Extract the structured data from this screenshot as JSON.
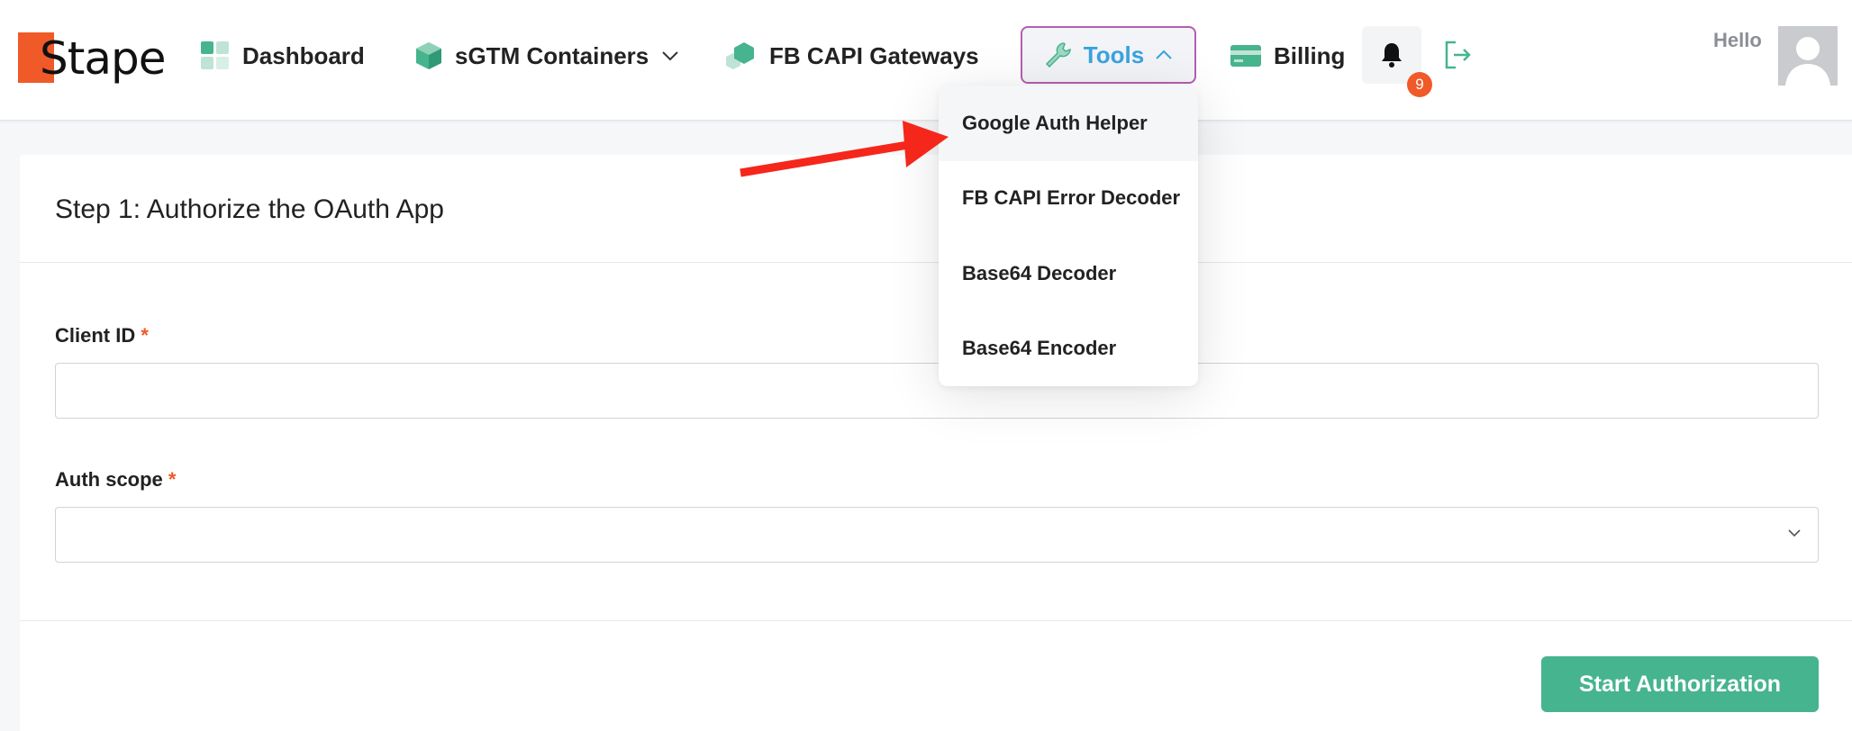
{
  "brand": {
    "name": "Stape",
    "accent": "#f05a28",
    "green": "#46b48e",
    "blue": "#3aa3e0"
  },
  "nav": {
    "dashboard": {
      "label": "Dashboard",
      "icon": "dashboard-grid-icon"
    },
    "containers": {
      "label": "sGTM Containers",
      "icon": "cube-icon"
    },
    "gateways": {
      "label": "FB CAPI Gateways",
      "icon": "hexagon-icon"
    },
    "tools": {
      "label": "Tools",
      "icon": "wrench-icon",
      "state": "open"
    },
    "billing": {
      "label": "Billing",
      "icon": "credit-card-icon"
    }
  },
  "notifications": {
    "count": "9",
    "icon": "bell-icon"
  },
  "user": {
    "greeting": "Hello",
    "avatar_icon": "user-avatar-icon"
  },
  "tools_menu": {
    "items": [
      {
        "label": "Google Auth Helper",
        "active": true
      },
      {
        "label": "FB CAPI Error Decoder"
      },
      {
        "label": "Base64 Decoder"
      },
      {
        "label": "Base64 Encoder"
      }
    ]
  },
  "form": {
    "title": "Step 1: Authorize the OAuth App",
    "client_id": {
      "label": "Client ID",
      "required_mark": "*",
      "value": "",
      "placeholder": ""
    },
    "auth_scope": {
      "label": "Auth scope",
      "required_mark": "*",
      "selected": ""
    },
    "submit_label": "Start Authorization"
  },
  "annotation": {
    "arrow_color": "#f5271b",
    "target": "Google Auth Helper"
  }
}
